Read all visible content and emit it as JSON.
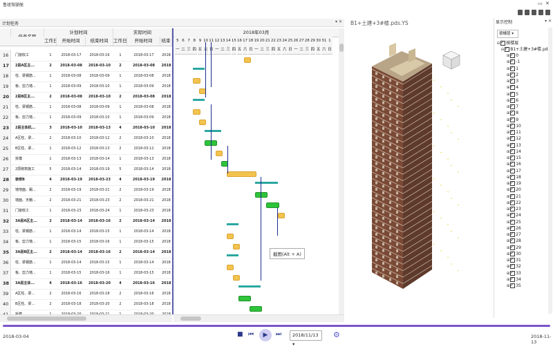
{
  "window": {
    "title": "鲁班驾驶舱",
    "restore_glyph": "▭",
    "close_glyph": "✕"
  },
  "left_panel": {
    "title": "计划任务",
    "pin": "▾ ✕"
  },
  "table": {
    "col_task": "任务名称",
    "group_plan": "计划时间",
    "group_actual": "实际时间",
    "col_workdays": "工作日",
    "col_start": "开始时间",
    "col_end": "结束时间",
    "col_workdays2": "工作日",
    "col_start2": "开始时间",
    "col_end2": "结束",
    "rows": [
      {
        "num": "16",
        "name": "门窗收工",
        "wd": "1",
        "start": "2018-03-17",
        "end": "2018-03-16",
        "wd2": "1",
        "start2": "2018-03-17",
        "end2": "2018",
        "bold": false
      },
      {
        "num": "17",
        "name": "2层A区主...",
        "wd": "2",
        "start": "2018-03-08",
        "end": "2018-03-10",
        "wd2": "2",
        "start2": "2018-03-08",
        "end2": "2018",
        "bold": true
      },
      {
        "num": "18",
        "name": "柱、梁钢筋...",
        "wd": "1",
        "start": "2018-03-08",
        "end": "2018-03-09",
        "wd2": "1",
        "start2": "2018-03-08",
        "end2": "2018",
        "bold": false
      },
      {
        "num": "19",
        "name": "板、剪力墙...",
        "wd": "1",
        "start": "2018-03-09",
        "end": "2018-03-10",
        "wd2": "1",
        "start2": "2018-03-09",
        "end2": "2018",
        "bold": false
      },
      {
        "num": "20",
        "name": "2层B区主...",
        "wd": "2",
        "start": "2018-03-08",
        "end": "2018-03-10",
        "wd2": "2",
        "start2": "2018-03-08",
        "end2": "2018",
        "bold": true
      },
      {
        "num": "21",
        "name": "柱、梁钢筋...",
        "wd": "1",
        "start": "2018-03-08",
        "end": "2018-03-09",
        "wd2": "1",
        "start2": "2018-03-08",
        "end2": "2018",
        "bold": false
      },
      {
        "num": "22",
        "name": "板、剪力墙...",
        "wd": "1",
        "start": "2018-03-09",
        "end": "2018-03-10",
        "wd2": "1",
        "start2": "2018-03-09",
        "end2": "2018",
        "bold": false
      },
      {
        "num": "23",
        "name": "2层主体机...",
        "wd": "3",
        "start": "2018-03-10",
        "end": "2018-03-13",
        "wd2": "4",
        "start2": "2018-03-10",
        "end2": "2018",
        "bold": true
      },
      {
        "num": "24",
        "name": "A区柱、梁...",
        "wd": "2",
        "start": "2018-03-10",
        "end": "2018-03-12",
        "wd2": "2",
        "start2": "2018-03-10",
        "end2": "2018",
        "bold": false
      },
      {
        "num": "25",
        "name": "B区柱、梁...",
        "wd": "1",
        "start": "2018-03-12",
        "end": "2018-03-13",
        "wd2": "2",
        "start2": "2018-03-12",
        "end2": "2018",
        "bold": false
      },
      {
        "num": "26",
        "name": "拆模",
        "wd": "1",
        "start": "2018-03-13",
        "end": "2018-03-14",
        "wd2": "1",
        "start2": "2018-03-13",
        "end2": "2018",
        "bold": false
      },
      {
        "num": "27",
        "name": "2层砌筑施工",
        "wd": "5",
        "start": "2018-03-14",
        "end": "2018-03-19",
        "wd2": "5",
        "start2": "2018-03-14",
        "end2": "2018",
        "bold": false
      },
      {
        "num": "28",
        "name": "装修B",
        "wd": "4",
        "start": "2018-03-19",
        "end": "2018-03-23",
        "wd2": "4",
        "start2": "2018-03-19",
        "end2": "2018",
        "bold": true
      },
      {
        "num": "29",
        "name": "墙地面、踢...",
        "wd": "2",
        "start": "2018-03-19",
        "end": "2018-03-21",
        "wd2": "2",
        "start2": "2018-03-19",
        "end2": "2018",
        "bold": false
      },
      {
        "num": "30",
        "name": "墙面、天棚...",
        "wd": "2",
        "start": "2018-03-21",
        "end": "2018-03-23",
        "wd2": "2",
        "start2": "2018-03-21",
        "end2": "2018",
        "bold": false
      },
      {
        "num": "31",
        "name": "门窗收工",
        "wd": "1",
        "start": "2018-03-23",
        "end": "2018-03-24",
        "wd2": "1",
        "start2": "2018-03-23",
        "end2": "2018",
        "bold": false
      },
      {
        "num": "32",
        "name": "3A层A区主...",
        "wd": "2",
        "start": "2018-03-14",
        "end": "2018-03-16",
        "wd2": "2",
        "start2": "2018-03-14",
        "end2": "2018",
        "bold": true
      },
      {
        "num": "33",
        "name": "柱、梁钢筋...",
        "wd": "1",
        "start": "2018-03-14",
        "end": "2018-03-15",
        "wd2": "1",
        "start2": "2018-03-14",
        "end2": "2018",
        "bold": false
      },
      {
        "num": "34",
        "name": "板、剪力墙...",
        "wd": "1",
        "start": "2018-03-15",
        "end": "2018-03-16",
        "wd2": "1",
        "start2": "2018-03-15",
        "end2": "2018",
        "bold": false
      },
      {
        "num": "35",
        "name": "3A层B区主...",
        "wd": "2",
        "start": "2018-03-14",
        "end": "2018-03-16",
        "wd2": "2",
        "start2": "2018-03-14",
        "end2": "2018",
        "bold": true
      },
      {
        "num": "36",
        "name": "柱、梁钢筋...",
        "wd": "1",
        "start": "2018-03-14",
        "end": "2018-03-15",
        "wd2": "1",
        "start2": "2018-03-14",
        "end2": "2018",
        "bold": false
      },
      {
        "num": "37",
        "name": "板、剪力墙...",
        "wd": "1",
        "start": "2018-03-15",
        "end": "2018-03-16",
        "wd2": "1",
        "start2": "2018-03-15",
        "end2": "2018",
        "bold": false
      },
      {
        "num": "38",
        "name": "3A层主体...",
        "wd": "4",
        "start": "2018-03-16",
        "end": "2018-03-20",
        "wd2": "4",
        "start2": "2018-03-16",
        "end2": "2018",
        "bold": true
      },
      {
        "num": "39",
        "name": "A区柱、梁...",
        "wd": "2",
        "start": "2018-03-16",
        "end": "2018-03-18",
        "wd2": "2",
        "start2": "2018-03-16",
        "end2": "2018",
        "bold": false
      },
      {
        "num": "40",
        "name": "B区柱、梁...",
        "wd": "2",
        "start": "2018-03-18",
        "end": "2018-03-20",
        "wd2": "2",
        "start2": "2018-03-18",
        "end2": "2018",
        "bold": false
      },
      {
        "num": "41",
        "name": "拆模",
        "wd": "1",
        "start": "2018-03-20",
        "end": "2018-03-21",
        "wd2": "1",
        "start2": "2018-03-20",
        "end2": "2018",
        "bold": false
      }
    ]
  },
  "gantt": {
    "month": "2018年03月",
    "days": [
      "5",
      "6",
      "7",
      "8",
      "9",
      "10",
      "11",
      "12",
      "13",
      "14",
      "15",
      "16",
      "17",
      "18",
      "19",
      "20",
      "21",
      "22",
      "23",
      "24",
      "25",
      "26",
      "27",
      "28",
      "29",
      "30",
      "31",
      "1"
    ],
    "weekdays": [
      "一",
      "二",
      "三",
      "四",
      "五",
      "六",
      "日",
      "一",
      "二",
      "三",
      "四",
      "五",
      "六",
      "日",
      "一",
      "二",
      "三",
      "四",
      "五",
      "六",
      "日",
      "一",
      "二",
      "三",
      "四",
      "五",
      "六",
      "日"
    ],
    "first_day": 5
  },
  "viewer": {
    "title": "B1+土建+3#楼.pds.YS",
    "tooltip": "截图(Alt + A)"
  },
  "right_panel": {
    "title": "显示控制",
    "pin": "▾ ✕",
    "dropdown": "按楼层",
    "tree_root": "按楼层",
    "tree_project": "B1+土建+3#楼.pds",
    "floors": [
      "0",
      "-1",
      "1",
      "2",
      "3",
      "4",
      "5",
      "6",
      "7",
      "8",
      "9",
      "10",
      "11",
      "12",
      "13",
      "14",
      "15",
      "16",
      "17",
      "18",
      "19",
      "20",
      "21",
      "22",
      "23",
      "24",
      "25",
      "26",
      "27",
      "28",
      "29",
      "30",
      "31",
      "32",
      "33",
      "34",
      "35"
    ]
  },
  "bottom": {
    "start_date": "2018-03-04",
    "end_date": "2018-11-13",
    "current_date": "2018/11/13",
    "stop": "■",
    "prev": "⏮",
    "play": "▶",
    "next": "⏭",
    "gear": "⚙",
    "progress": 1.0
  },
  "colors": {
    "accent": "#7b53c9",
    "bar_green": "#2ec43a",
    "bar_yellow": "#f3c34f",
    "summary": "#2aa7a0",
    "dependency": "#1a2b8f"
  }
}
